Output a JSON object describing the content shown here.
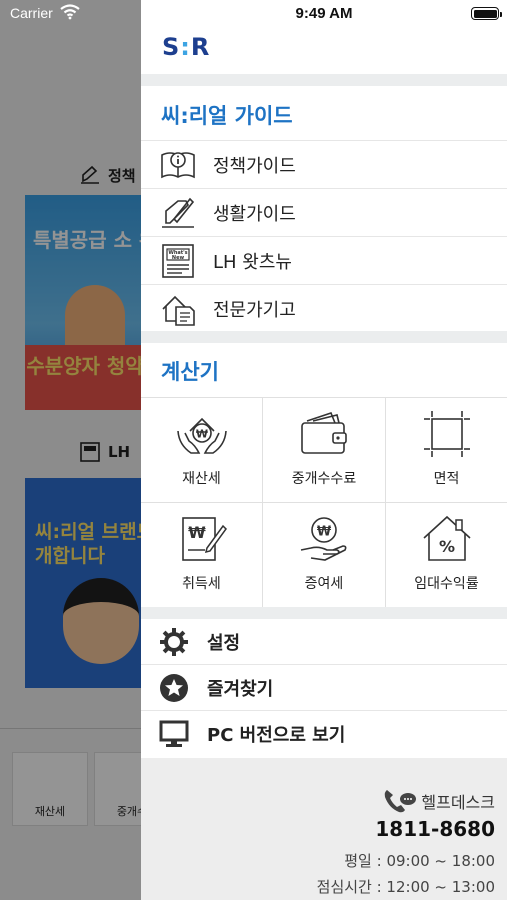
{
  "status_bar": {
    "carrier": "Carrier",
    "time": "9:49 AM"
  },
  "background_app": {
    "section1_label": "정책",
    "section1_banner_text": "특별공급 소 완화 및",
    "section1_banner_bottom": "수분양자 청약",
    "section2_label": "LH",
    "section2_banner_text": "씨:리얼 브랜드 소개합니다",
    "bottom_tiles": [
      "재산세",
      "중개수"
    ]
  },
  "drawer": {
    "logo": {
      "left": "S",
      "sep": ":",
      "right": "R"
    },
    "guide_section": {
      "title": "씨:리얼 가이드",
      "items": [
        {
          "label": "정책가이드",
          "icon": "policy-book-icon"
        },
        {
          "label": "생활가이드",
          "icon": "pen-note-icon"
        },
        {
          "label": "LH 왓츠뉴",
          "icon": "whats-new-icon"
        },
        {
          "label": "전문가기고",
          "icon": "document-house-icon"
        }
      ]
    },
    "calculator_section": {
      "title": "계산기",
      "items": [
        {
          "label": "재산세",
          "icon": "property-tax-icon"
        },
        {
          "label": "중개수수료",
          "icon": "wallet-icon"
        },
        {
          "label": "면적",
          "icon": "area-icon"
        },
        {
          "label": "취득세",
          "icon": "acquisition-tax-icon"
        },
        {
          "label": "증여세",
          "icon": "gift-tax-icon"
        },
        {
          "label": "임대수익률",
          "icon": "rental-yield-icon"
        }
      ]
    },
    "utility": {
      "settings": "설정",
      "favorites": "즐겨찾기",
      "pc_version": "PC 버전으로 보기"
    },
    "helpdesk": {
      "label": "헬프데스크",
      "phone": "1811-8680",
      "weekday_hours": "평일 : 09:00 ~ 18:00",
      "lunch_hours": "점심시간 : 12:00 ~ 13:00"
    },
    "colors": {
      "accent": "#1e73c4",
      "logo_dark": "#1d3f8f",
      "logo_light": "#3da4e3",
      "gap": "#ebedee"
    }
  }
}
